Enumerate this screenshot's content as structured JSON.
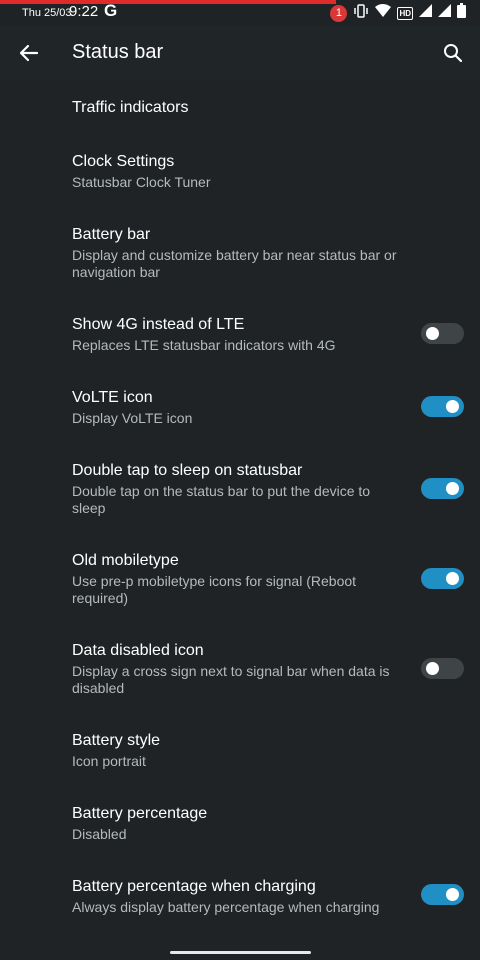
{
  "status_bar": {
    "date": "Thu 25/03",
    "time": "9:22",
    "app_icon": "G",
    "notification_count": "1",
    "hd_label": "HD",
    "progress_fraction": 0.7,
    "progress_color": "#e02b2b"
  },
  "header": {
    "title": "Status bar",
    "back_icon": "arrow-left-icon",
    "search_icon": "search-icon"
  },
  "settings": [
    {
      "title": "Traffic indicators",
      "summary": "",
      "toggle": null
    },
    {
      "title": "Clock Settings",
      "summary": "Statusbar Clock Tuner",
      "toggle": null
    },
    {
      "title": "Battery bar",
      "summary": "Display and customize battery bar near status bar or navigation bar",
      "toggle": null
    },
    {
      "title": "Show 4G instead of LTE",
      "summary": "Replaces LTE statusbar indicators with 4G",
      "toggle": false
    },
    {
      "title": "VoLTE icon",
      "summary": "Display VoLTE icon",
      "toggle": true
    },
    {
      "title": "Double tap to sleep on statusbar",
      "summary": "Double tap on the status bar to put the device to sleep",
      "toggle": true
    },
    {
      "title": "Old mobiletype",
      "summary": "Use pre-p mobiletype icons for signal (Reboot required)",
      "toggle": true
    },
    {
      "title": "Data disabled icon",
      "summary": "Display a cross sign next to signal bar when data is disabled",
      "toggle": false
    },
    {
      "title": "Battery style",
      "summary": "Icon portrait",
      "toggle": null
    },
    {
      "title": "Battery percentage",
      "summary": "Disabled",
      "toggle": null
    },
    {
      "title": "Battery percentage when charging",
      "summary": "Always display battery percentage when charging",
      "toggle": true
    }
  ],
  "colors": {
    "background": "#1f2325",
    "accent": "#1f8fc4",
    "toggle_off": "#3f4446",
    "summary_text": "#b5babd"
  }
}
